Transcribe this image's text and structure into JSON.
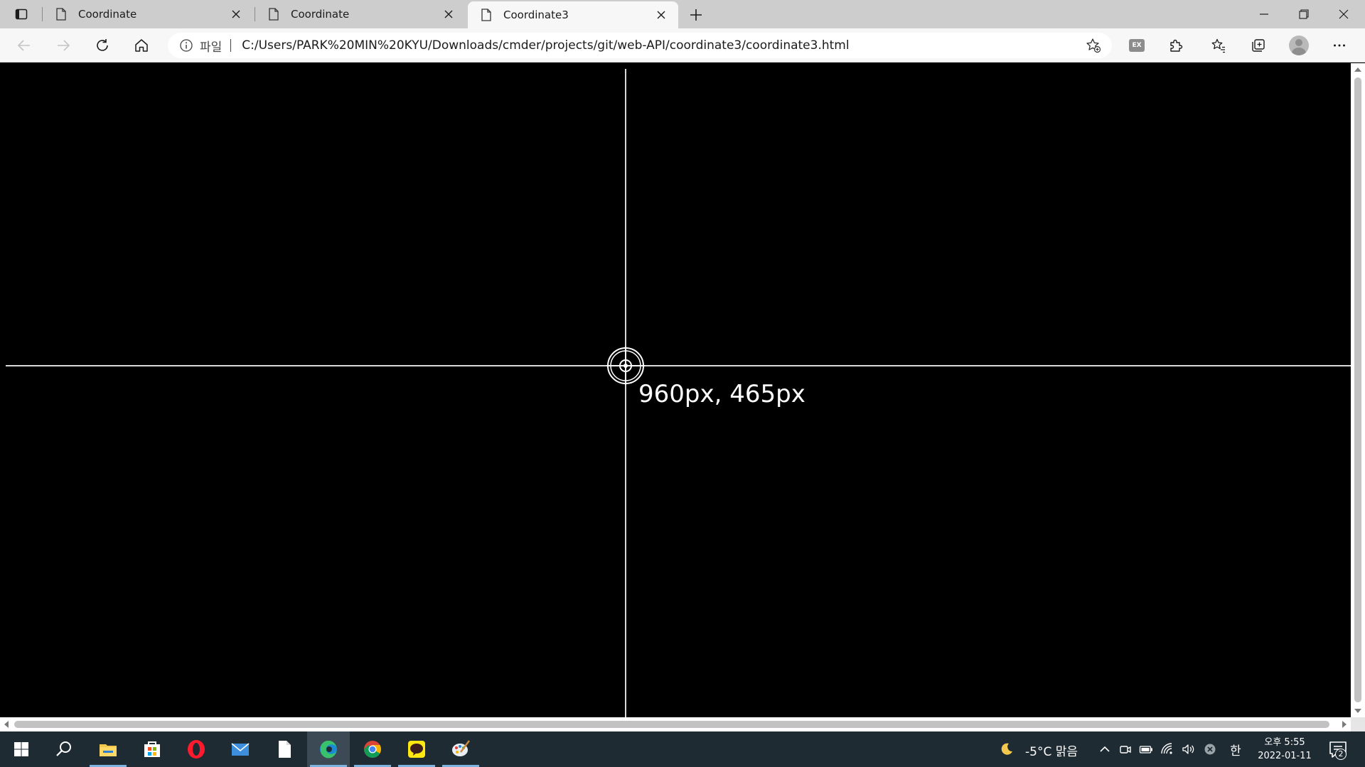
{
  "browser": {
    "tabs": [
      {
        "title": "Coordinate",
        "active": false
      },
      {
        "title": "Coordinate",
        "active": false
      },
      {
        "title": "Coordinate3",
        "active": true
      }
    ],
    "address": {
      "scheme_label": "파일",
      "url": "C:/Users/PARK%20MIN%20KYU/Downloads/cmder/projects/git/web-API/coordinate3/coordinate3.html"
    },
    "extension_badge": "EX"
  },
  "page": {
    "background": "#000000",
    "line_color": "#d9d9d9",
    "coordinate_readout": "960px, 465px"
  },
  "taskbar": {
    "weather": "-5°C 맑음",
    "ime": "한",
    "clock_time": "오후 5:55",
    "clock_date": "2022-01-11",
    "notification_count": "2",
    "apps": [
      "start-icon",
      "search-icon",
      "file-explorer-icon",
      "store-icon",
      "opera-icon",
      "mail-icon",
      "notepad-icon",
      "edge-icon",
      "chrome-icon",
      "kakaotalk-icon",
      "paint-icon"
    ]
  }
}
